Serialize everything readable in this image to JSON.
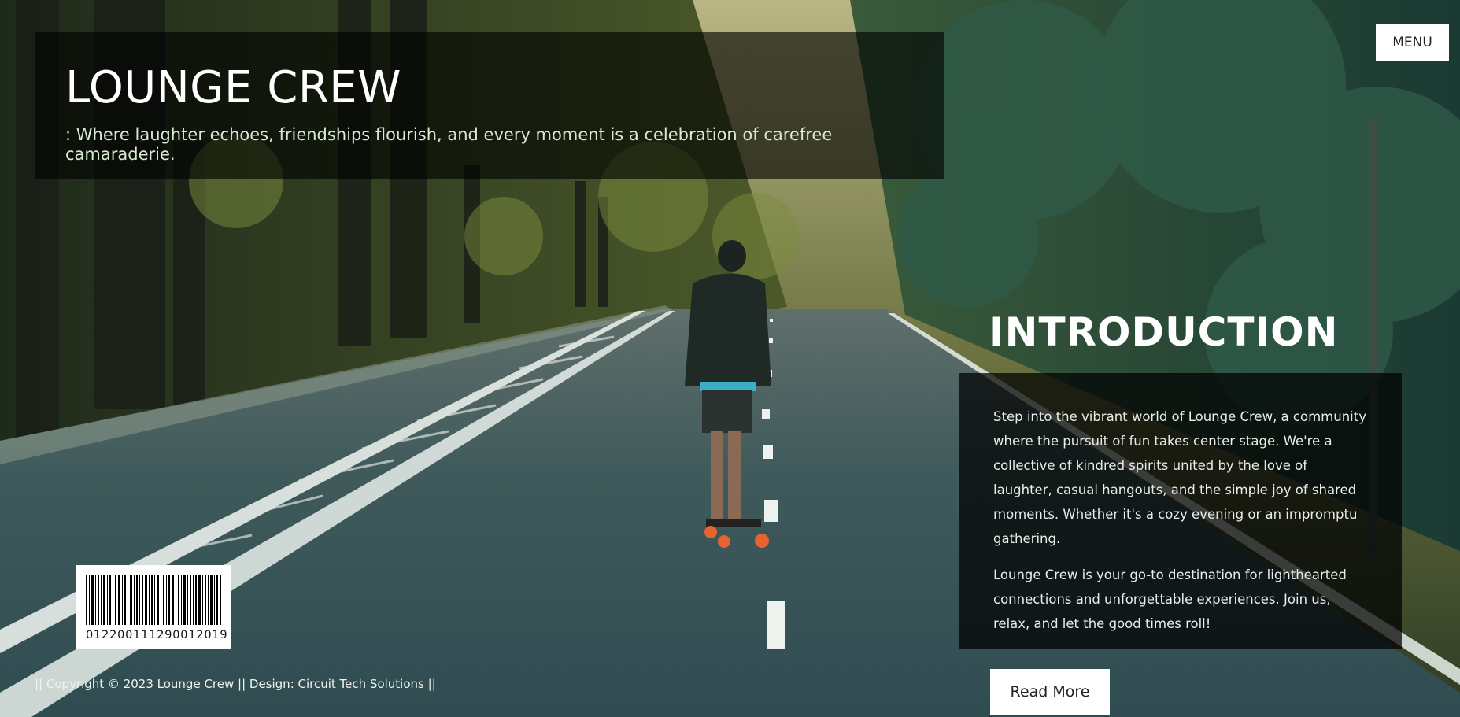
{
  "header": {
    "title": "LOUNGE CREW",
    "tagline": ": Where laughter echoes, friendships flourish, and every moment is a celebration of carefree camaraderie."
  },
  "menu": {
    "label": "MENU"
  },
  "intro": {
    "title": "INTRODUCTION",
    "paragraphs": [
      "Step into the vibrant world of Lounge Crew, a community where the pursuit of fun takes center stage. We're a collective of kindred spirits united by the love of laughter, casual hangouts, and the simple joy of shared moments. Whether it's a cozy evening or an impromptu gathering.",
      "Lounge Crew is your go-to destination for lighthearted connections and unforgettable experiences. Join us, relax, and let the good times roll!"
    ],
    "button_label": "Read More"
  },
  "barcode": {
    "number": "012200111290012019"
  },
  "footer": {
    "text": "|| Copyright © 2023 Lounge Crew || Design: Circuit Tech Solutions ||"
  },
  "background": {
    "scene": "skateboarder-on-forest-road",
    "colors": {
      "sky": "#c8b785",
      "forest": "#224034",
      "road": "#3c5659",
      "wheel": "#e86333"
    }
  }
}
